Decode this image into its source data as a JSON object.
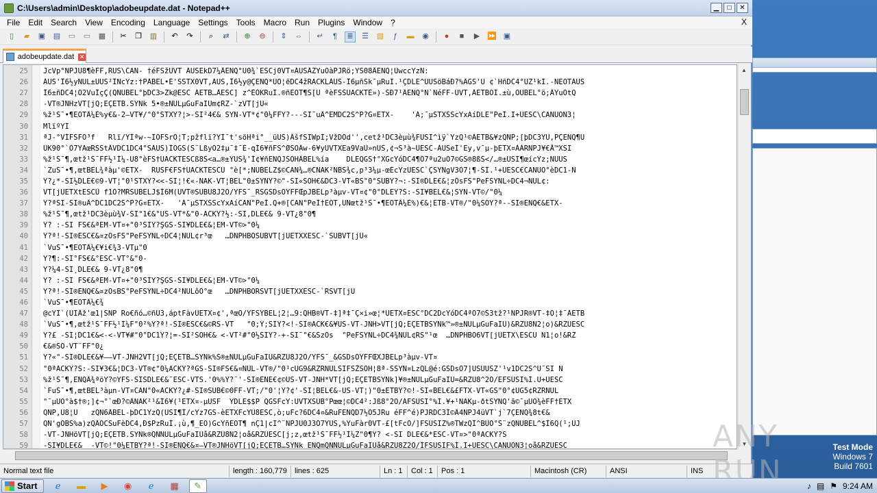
{
  "window": {
    "title": "C:\\Users\\admin\\Desktop\\adobeupdate.dat - Notepad++"
  },
  "menu": {
    "items": [
      "File",
      "Edit",
      "Search",
      "View",
      "Encoding",
      "Language",
      "Settings",
      "Tools",
      "Macro",
      "Run",
      "Plugins",
      "Window",
      "?"
    ],
    "close_label": "X"
  },
  "tabs": [
    {
      "label": "adobeupdate.dat"
    }
  ],
  "editor": {
    "lines": [
      {
        "n": "25",
        "text": "JcVp°NPJÜ8¶èFF,RUS\\CAN- †éFSžÜVT ÁUSEkD7¼ÂENQ°Ù0¾`ESCj0VT¤ÁUSÂZYuÕàPJRö;YS08ÂENQ¦ÙwccYzÑ:"
      },
      {
        "n": "26",
        "text": "ÁUS'Î6½yNUL±ÜUS²ÎNcYz:†PÁBEL•È'SSTX0VT,ÁUS,Î6½y@ÇENQ*ÙO¦ëDC4žRACKLÁUS-Î6µñSk¯µRuÍ.¹ÇDLE^ÜUSöBáÐ?%ÂGS'Ù ¢`HñDC4°ÚZ¹kÍ.-ÑEOTÁUS"
      },
      {
        "n": "27",
        "text": "Î6±ñDC4¦Ó2VuÎçÇ(QNÜBEL°þDC3>Zk@ESC ÁETB…ÂESC] z^ÈÓKRuÍ.®ñEOT¶S[Ü ªèFSŠÚACKTÉ»)-ŠÐ7¹ÂENQ°Ñ`NéFF-ÚVT,ÂETBÕÍ.±ù,OÙBEL°ö;ÂYuÕtQ"
      },
      {
        "n": "28",
        "text": "-VT®JÑHzVT[jQ;EÇETB.SYNk 5•®±NULµGuFaIÙm¢RZ-`zVT[jÜ«"
      },
      {
        "n": "29",
        "text": "%ž¹Š¯•¶EOTÂ¼È%y€&-2—VT¥/\"0°STXŸ?¦>-SI²4€& SYN-VT*¢\"0¼FFŸ?---SI¯uÂ^EMDC2S^P?G¤ETX-    'Á;¯µSTXŠScYxAíDLE\"PeÍ.I+ÜESC\\CANÙON3¦"
      },
      {
        "n": "30",
        "text": "MlïºYÍ"
      },
      {
        "n": "31",
        "text": "ªJ-°VÍFSFÓ³f   Rlï/YÍªw-~IÕFSrÒ¦T;pžflï?YÍ¯t'söHªi°__üUS)ÂšfSIWpÌ;VžDÓd'',cetž¹DC3èµù¾FÜSI^ìÿ`YzQ¹©ÂETB&¥zQNP;[þDC3ŸÜ,PÇENQ¶Ü"
      },
      {
        "n": "32",
        "text": "ÚK90°`Ò7YAœRSStÂVDC1DC4°SÁUS)ÍÕGS(S¨LßyÓ2‡µ¯‡¯È-qÍ6¥ñFS^ØSOÂw-6¥yÜVTXEa9VaÜ»nUS,¢¬Š³à~ÜESC-ÁUSeÍ'Ey,v¯µ-þETX¤ÀÀRNPJ¥€Å™XSI"
      },
      {
        "n": "33",
        "text": "%ž¹Š¯¶,œtž¹Š¯FF½¹Í¼-Ü8°èFS†ÜACKTESCß8Š<a…®±ÝUS¾'Í¢¥ñENQJSOHÂBEL%ía    DLEQGS†°XGcYóDC4¶Ó7ªu2uÒ7©GS®8ßŠ</…®±ÜSI¶œícYz;NÜUS"
      },
      {
        "n": "34",
        "text": "`ZuŠ¯•¶,œtBEL¾ªàµ'©ETX-  RUSF€FS†ÜACKTESCÜ °è[*;NÚBELZ$©CAN¾…®CNAK²ÑBS¾c,p³3¼µ-œÉcYzÜESC`ÇSYNgV3Ò7¦¶-ŠÍ.¹+ÜESC€CANÙO°èDC1-Ñ"
      },
      {
        "n": "35",
        "text": "Ÿ?¿*-SI½DLE€©9-VT¦\"0¹STXŸ?<<-SI¦!€«-NAK-VT¦BEL\"0±SYNŸ?©\"-SI«SOH€&DC3-VT«BS\"0°SUBŸ?¬:-SI®DLE€&¦zÔsFS\"PeFSYNL÷DC4¬NUL¢:"
      },
      {
        "n": "36",
        "text": "VT[jÜETXtESCÙ f1Ò?MRSÜBELJ$Í6M(ÜVT®SUBÜ8J2Ò/YFS¯_RSGSDsÓŸFFŒpJBELp³àµv-VT¤¢\"0°DLEŸ?S:-SI¥BEL€&¦SYN-VT©/\"0¼"
      },
      {
        "n": "37",
        "text": "Ÿ?ªSI-SI®uÂ^DC1DC2S^P?G¤ETX-   'Á¯µSTXŠScYxAíCAN\"PeÍ.Q+®[CAN\"PeÍ†EOT,UNœtž¹Š¯•¶EOTÂ¼È%)€&¦ETB-VT®/\"0¼SOŸ?ª--SI®ENQ€&ETX-"
      },
      {
        "n": "38",
        "text": "%ž¹Š¯¶,œtž¹DC3èµù¾V-SI°1€&°US-VT*&\"0-ACKŸ?½:-SI,DLE€& 9-VT¿8\"0¶"
      },
      {
        "n": "39",
        "text": "Ÿ? :-SI FS€&ªEM-VT¤+\"0³SIŸ?ŞGS-SI¥DLE€&¦EM-VT©>\"0¼"
      },
      {
        "n": "40",
        "text": "Ÿ?ª!-SI®ESC€&¤zÖsFS\"PeFSYNL÷DC4¦NUL¢r³œ   …DNPHBÖSUBVT[jÜETXXESC-`SUBVT[jÜ«"
      },
      {
        "n": "41",
        "text": "`VuŠ¯•¶EOTÂ¼€¥i€¾3-VTµ\"0"
      },
      {
        "n": "42",
        "text": "Ÿ?¶:-SI°FS€&°ESC-VT°&\"0-"
      },
      {
        "n": "43",
        "text": "Ÿ?¼4-SI¸DLE€& 9-VT¿8\"0¶"
      },
      {
        "n": "44",
        "text": "Ÿ? :-SI FS€&ªEM-VT¤+\"0³SIŸ?ŞGS-SI¥DLE€&¦EM-VT©>\"0¼"
      },
      {
        "n": "45",
        "text": "Ÿ?ª!-SI®ENQ€&¤zÖsBS\"PeFSYNL÷DC4²NULôÒ°œ   …DNPHBÖRSVT[jÜETXXESC-`RSVT[jÜ"
      },
      {
        "n": "46",
        "text": "`VuŠ¯•¶EOTÂ¼€¾"
      },
      {
        "n": "47",
        "text": "@cYÏ`(ÙÏÂž'œ1|SNP Ro€ñó…©ñU3,áptFàvÜETX¤¢',ªœÖ/YFSŸBEL¦2¦…9:QHB®VT-‡]ª‡¯Ç×i»œ¦*ÜETX¤ESC°DC2DcYóDC4ªÓ7©Š3tž?¹NPJR®VT-‡Õ¦‡¯ÁETB"
      },
      {
        "n": "48",
        "text": "`VuŠ¯•¶,œtž¹Š¯FF½¹Í¼F\"0²%Ÿ?ª!-SI®ESC€&©RS-VT   \"0;Ý;SIŸ?<!-SI®ACK€&¥US-VT-JÑH>VT[jQ;EÇETBSYNk™»®±NULµGuFaIÙ)&RZÜ8N2¦o)&RZÜESC"
      },
      {
        "n": "49",
        "text": "Ÿ?£ -SI¦DC1€&<-<-VT¥#\"0°DC1Ÿ?¦=-SI²SOH€& <-VT²#\"0½SIŸ?-+-SI¯\"€&ŠzÖs  \"PeFSYNL÷DC4¾NUL¢RS\"¹œ  …DNPHBÖ6VT[jÜETX\\ESCÙ N1¦o!&RZ"
      },
      {
        "n": "50",
        "text": "€&®SO-VT¨FF\"0¿"
      },
      {
        "n": "51",
        "text": "Ÿ?«\"-SI®DLE€&¥——VT-JÑH2VT[jQ;EÇETB…SYNk%Š®±NULµGuFaIÙ&RZÜ8J2Ò/YFS¯_&GSDsÓŸFFŒXJBELp³àµv-VT¤"
      },
      {
        "n": "52",
        "text": "\"0ªACKŸ?S:-SI¥3€&¦DC3-VT®¢\"0¼ACKŸ?ªGS-SI®FS€&¤NUL-VT®/\"0¹cÜG9&RZRNULSIFSŽSOH¦8ª-ŠSYN¤LzQL@é:GSDsÒ7]USÜUSZ'¹v1DC2S^Ü¯SI N"
      },
      {
        "n": "53",
        "text": "%ž¹Š¯¶,ENQÂ¾ªöY?©YFS-SIŠDLE€&¯ESC-VTS.'0%%Ÿ?¨'-SI®ENE€¢©US-VT-JÑH*VT[jQ;EÇETBSYNk]¥®±NULµGuFaIÙ=&RZÜ8^2Ò/EFSÜSI%Í.U+ÜESC"
      },
      {
        "n": "54",
        "text": "`FuŠ¯•¶,œtBEL³àµn-VT¤CAN\"0«ACKŸ?¿#-SI®SUB€©0FF-VT;/\"0'¦Ÿ?¢'-SI¦BEL€&-US-VT¦)\"0±ETBŸ?©!-SI«BEL€&£FTX-VT«GS\"0°¢ÜG5¢RZRNUL"
      },
      {
        "n": "55",
        "text": "\"¯µÜO°à$†®;]¢¬°`œÐ?©ÂNAK²¹&Í6¥(¹ETX¤-µUSF  YDLE$$P QGSFcY:ÜVTXSUB°Pœœ¦©DC4²:Jß8°2Ò/ÁFSÜSI°%Í.¥+¹NAKµ-ðtSYNQ'ã©¯µÜO¾èFF†ETX"
      },
      {
        "n": "56",
        "text": "QNP,Ü8¦Ü   zQN6ÂBEL-þDC1YzQ(ÜSI¶Í/cYz7GS-èETXFcYÜ8ESC,ò;uFc?6DC4¤&RuFENQD7½Ó5JRu éFF^é)PJRDC3Ì©Â4NPJ4üVT`j`7ÇENQ¾8t€&"
      },
      {
        "n": "57",
        "text": "QN'gÓBS%a)zQÂÖCSuFèDC4,Ð$PzRuÍ.¡ù,¶_EÕ)GcYñEOT¶ nÇ1|cI^¨NPJÜ0J3Ó7YUS,%YuFàr0VT-£[tFcÒ/]FSÜSIZ%®TWzQÍ^BÜO°Š¨zQNÜBEL^$Í6Q(¹;UJ"
      },
      {
        "n": "58",
        "text": "-VT-JÑHöVT[jQ;EÇETB.SYNk®QNNULµGuFaIÙå&RZÜ8N2¦oå&RZÜESC[j;z,œtž¹Š¯FF½¹Í¼Z\"0¶Ÿ? <-SI DLE€&*ESC-VT¤>\"0ªACKŸ?S"
      },
      {
        "n": "59",
        "text": "-SI¥DLE€&  -VT©!\"0¼ETBŸ?ª!-SI®ENQ€&¤—VT®JÑHöVT[jQ;EÇETB…SYNk ENQmQNNULµGuFaIÙå&RZÜ8Z2Ò/ÍFSÜSIF%Í.I+ÜESC\\CANÙON3¦oå&RZÜESC"
      }
    ]
  },
  "statusbar": {
    "filetype": "Normal text file",
    "length": "length : 160,779",
    "lines": "lines : 625",
    "ln": "Ln : 1",
    "col": "Col : 1",
    "pos": "Pos : 1",
    "eol": "Macintosh (CR)",
    "encoding": "ANSI",
    "mode": "INS"
  },
  "watermark": {
    "text": "ANY RUN"
  },
  "testmode": {
    "line1": "Test Mode",
    "line2": "Windows 7",
    "line3": "Build 7601"
  },
  "taskbar": {
    "start_label": "Start",
    "clock": "9:24 AM"
  }
}
